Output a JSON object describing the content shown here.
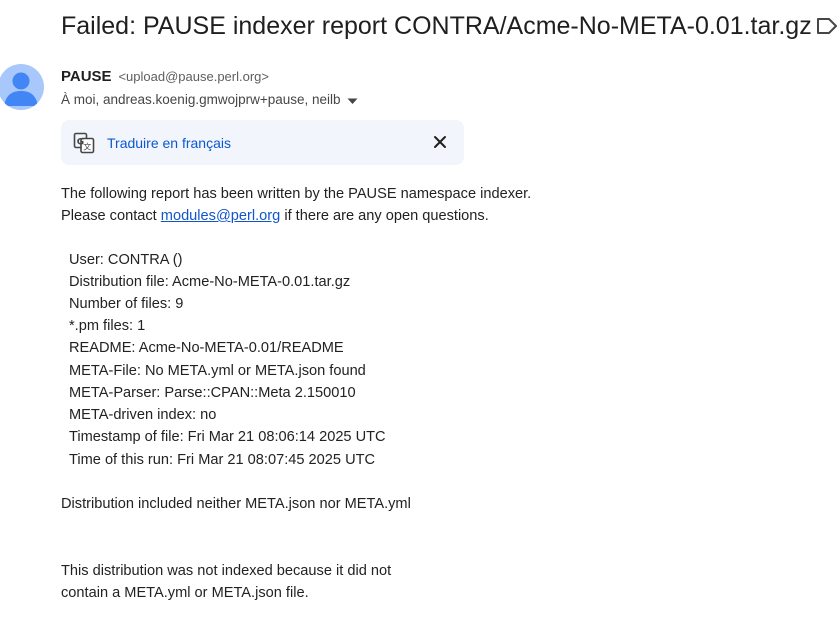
{
  "subject": "Failed: PAUSE indexer report CONTRA/Acme-No-META-0.01.tar.gz",
  "sender": {
    "name": "PAUSE",
    "email": "<upload@pause.perl.org>",
    "recipients": "À moi, andreas.koenig.gmwojprw+pause, neilb"
  },
  "translate": {
    "link": "Traduire en français"
  },
  "message": {
    "intro_line1": "The following report has been written by the PAUSE namespace indexer.",
    "intro_line2_before": "Please contact ",
    "intro_link": "modules@perl.org",
    "intro_line2_after": " if there are any open questions.",
    "report_lines": [
      "User: CONTRA ()",
      "Distribution file: Acme-No-META-0.01.tar.gz",
      "Number of files: 9",
      "*.pm files: 1",
      "README: Acme-No-META-0.01/README",
      "META-File: No META.yml or META.json found",
      "META-Parser: Parse::CPAN::Meta 2.150010",
      "META-driven index: no",
      "Timestamp of file: Fri Mar 21 08:06:14 2025 UTC",
      "Time of this run: Fri Mar 21 08:07:45 2025 UTC"
    ],
    "summary": "Distribution included neither META.json nor META.yml",
    "closing_line1": "This distribution was not indexed because it did not",
    "closing_line2": "contain a META.yml or META.json file."
  }
}
